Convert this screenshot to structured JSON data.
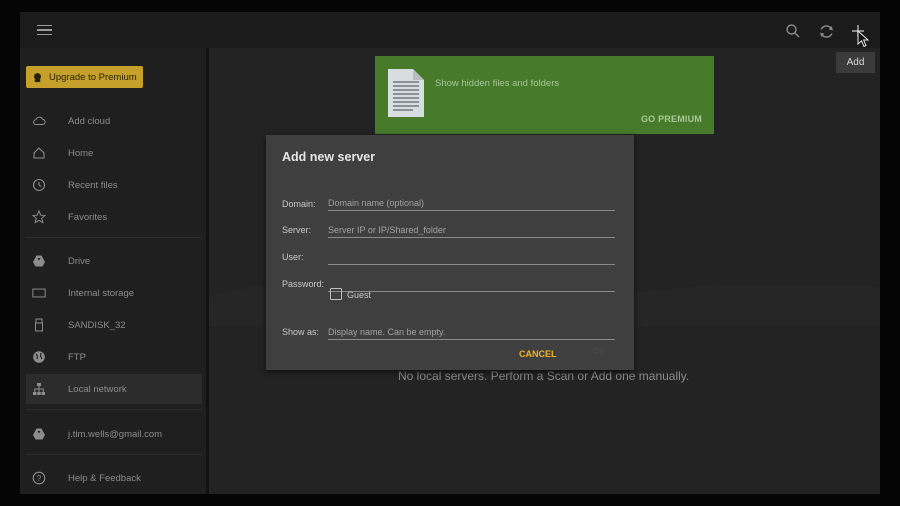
{
  "topbar": {
    "menu_icon": "hamburger-icon",
    "search_icon": "search-icon",
    "sync_icon": "sync-icon",
    "add_icon": "plus-icon",
    "tooltip": "Add"
  },
  "sidebar": {
    "premium_label": "Upgrade to Premium",
    "items": [
      {
        "label": "Add cloud",
        "icon": "cloud-icon"
      },
      {
        "label": "Home",
        "icon": "home-icon"
      },
      {
        "label": "Recent files",
        "icon": "clock-icon"
      },
      {
        "label": "Favorites",
        "icon": "star-icon"
      },
      {
        "label": "Drive",
        "icon": "drive-icon"
      },
      {
        "label": "Internal storage",
        "icon": "tablet-icon"
      },
      {
        "label": "SANDISK_32",
        "icon": "usb-icon"
      },
      {
        "label": "FTP",
        "icon": "globe-icon"
      },
      {
        "label": "Local network",
        "icon": "network-icon"
      },
      {
        "label": "j.tim.wells@gmail.com",
        "icon": "drive-icon"
      },
      {
        "label": "Help & Feedback",
        "icon": "help-icon"
      }
    ]
  },
  "promo": {
    "text": "Show hidden files and folders",
    "action": "GO PREMIUM"
  },
  "content": {
    "empty_message": "No local servers. Perform a Scan or Add one manually."
  },
  "dialog": {
    "title": "Add new server",
    "domain_label": "Domain:",
    "domain_placeholder": "Domain name (optional)",
    "server_label": "Server:",
    "server_placeholder": "Server IP or IP/Shared_folder",
    "user_label": "User:",
    "password_label": "Password:",
    "guest_label": "Guest",
    "showas_label": "Show as:",
    "showas_placeholder": "Display name. Can be empty.",
    "cancel_label": "CANCEL",
    "ok_label": "OK"
  },
  "colors": {
    "accent": "#f0b424",
    "premium": "#c5a02a",
    "promo_bg": "#477a2a",
    "dialog_bg": "#3f3f3f"
  }
}
